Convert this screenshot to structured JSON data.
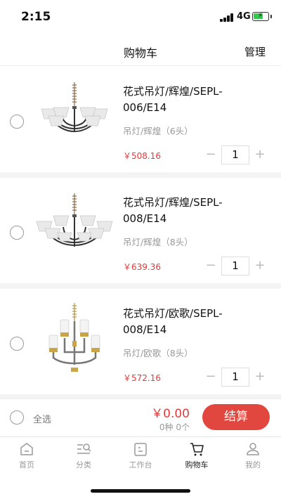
{
  "status_bar": {
    "time": "2:15",
    "network": "4G"
  },
  "header": {
    "title": "购物车",
    "manage_label": "管理"
  },
  "cart_items": [
    {
      "name": "花式吊灯/辉煌/SEPL-006/E14",
      "spec": "吊灯/辉煌（6头）",
      "price": "￥508.16",
      "quantity": "1"
    },
    {
      "name": "花式吊灯/辉煌/SEPL-008/E14",
      "spec": "吊灯/辉煌（8头）",
      "price": "￥639.36",
      "quantity": "1"
    },
    {
      "name": "花式吊灯/欧歌/SEPL-008/E14",
      "spec": "吊灯/欧歌（8头）",
      "price": "￥572.16",
      "quantity": "1"
    }
  ],
  "stepper": {
    "minus": "−",
    "plus": "+"
  },
  "checkout": {
    "select_all_label": "全选",
    "total": "￥0.00",
    "count": "0种 0个",
    "button_label": "结算"
  },
  "tabs": [
    {
      "label": "首页",
      "icon": "home-icon"
    },
    {
      "label": "分类",
      "icon": "category-icon"
    },
    {
      "label": "工作台",
      "icon": "workbench-icon"
    },
    {
      "label": "购物车",
      "icon": "cart-icon"
    },
    {
      "label": "我的",
      "icon": "profile-icon"
    }
  ],
  "colors": {
    "accent": "#e1473f",
    "price": "#e03b3b",
    "battery": "#32c94e"
  }
}
